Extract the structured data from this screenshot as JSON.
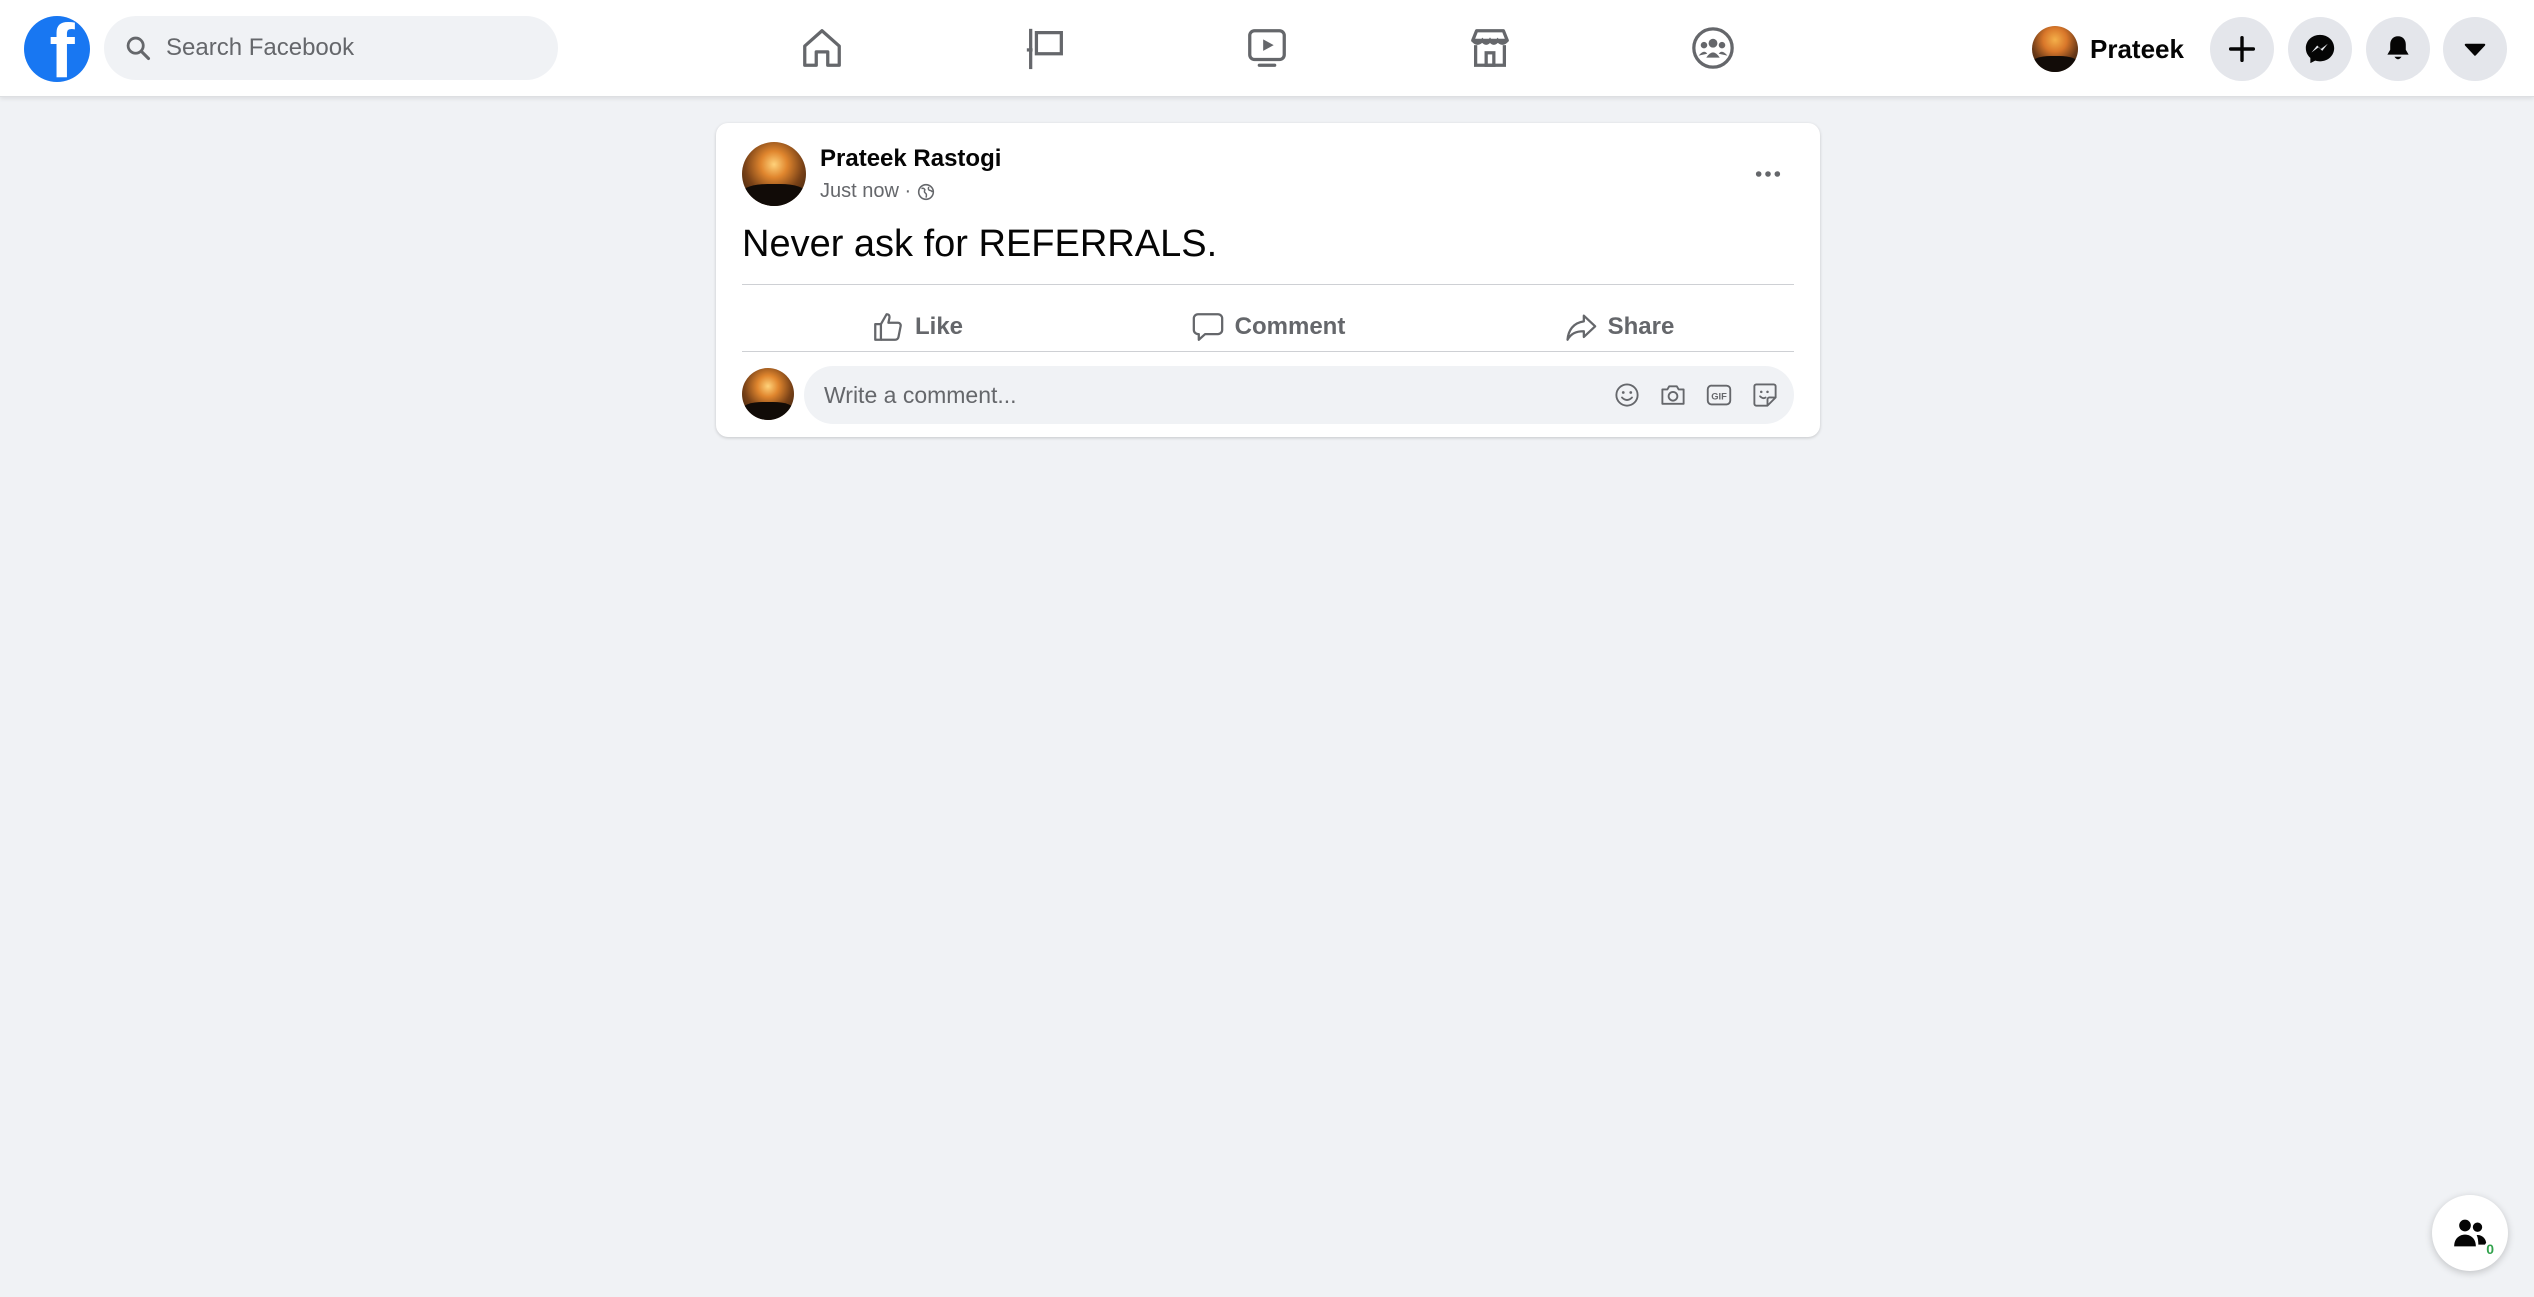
{
  "topbar": {
    "logo_letter": "f",
    "search_placeholder": "Search Facebook",
    "nav_icons": [
      "home-icon",
      "flag-icon",
      "video-icon",
      "marketplace-icon",
      "groups-icon"
    ],
    "profile_name": "Prateek",
    "actions": [
      "create-plus-icon",
      "messenger-icon",
      "notifications-bell-icon",
      "account-caret-icon"
    ]
  },
  "post": {
    "author": "Prateek Rastogi",
    "time": "Just now ·",
    "privacy_icon": "globe-icon",
    "text": "Never ask for REFERRALS.",
    "actions": {
      "like": "Like",
      "comment": "Comment",
      "share": "Share"
    },
    "comment_placeholder": "Write a comment...",
    "comment_tools": [
      "emoji-icon",
      "camera-icon",
      "gif-icon",
      "sticker-icon"
    ]
  },
  "contacts_fab": {
    "count": "0"
  },
  "colors": {
    "brand": "#1877f2",
    "background": "#f0f2f5",
    "secondary_text": "#65676b",
    "online_green": "#31a24c"
  }
}
